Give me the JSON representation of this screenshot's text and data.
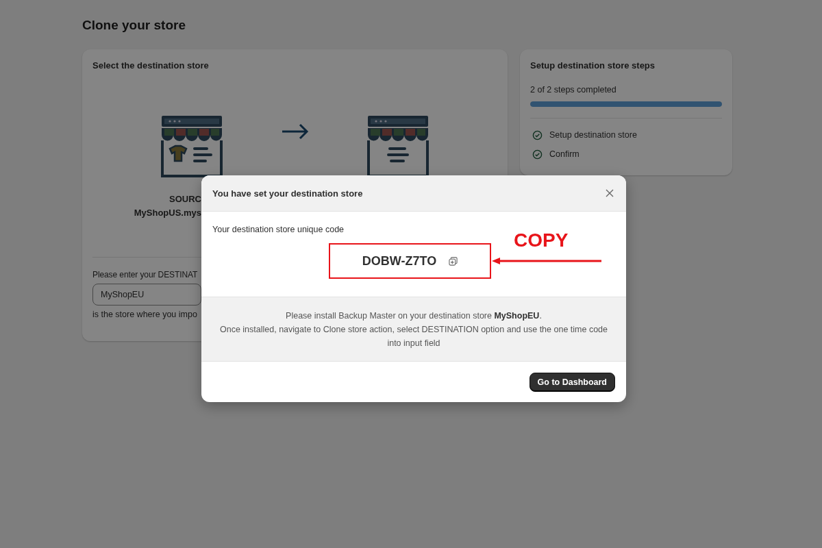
{
  "page": {
    "title": "Clone your store"
  },
  "store_card": {
    "title": "Select the destination store",
    "source_label": "SOURC",
    "source_domain": "MyShopUS.mys",
    "field_label": "Please enter your DESTINAT",
    "field_value": "MyShopEU",
    "field_hint": "is the store where you impo"
  },
  "steps_card": {
    "title": "Setup destination store steps",
    "progress_text": "2 of 2 steps completed",
    "level": 1.0,
    "steps": [
      {
        "label": "Setup destination store",
        "checked": true
      },
      {
        "label": "Confirm",
        "checked": true
      }
    ]
  },
  "modal": {
    "title": "You have set your destination store",
    "code_label": "Your destination store unique code",
    "code": "DOBW-Z7TO",
    "info": [
      "Please install Backup Master on your destination store **MyShopEU**.",
      "Once installed, navigate to Clone store action, select DESTINATION option and use the one time code into input field"
    ],
    "button": "Go to Dashboard"
  },
  "annotation": {
    "text": "COPY"
  }
}
